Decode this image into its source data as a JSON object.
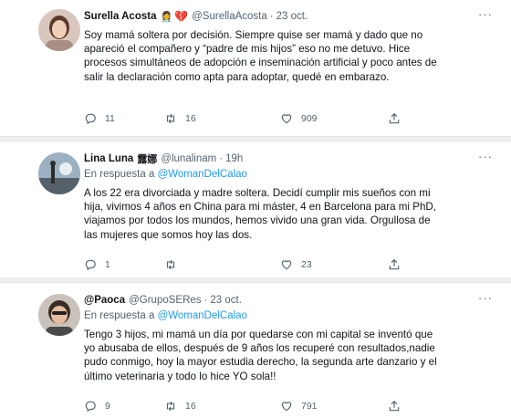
{
  "tweets": [
    {
      "name": "Surella Acosta",
      "badges": "👩‍⚕️",
      "heart": "💔",
      "handle": "@SurellaAcosta",
      "time": "23 oct.",
      "reply_prefix": "",
      "reply_mention": "@WomanDelCalao",
      "text": "Soy mamá soltera por decisión. Siempre quise ser mamá y dado que no\napareció el compañero y “padre de mis hijos” eso no me detuvo. Hice\nprocesos simultáneos de adopción e inseminación artificial y poco antes de\nsalir la declaración como apta para adoptar, quedé en embarazo.",
      "replies": "11",
      "retweets": "16",
      "likes": "909"
    },
    {
      "name": "Lina Luna",
      "badges": "露娜",
      "handle": "@lunalinam",
      "time": "19h",
      "reply_prefix": "En respuesta a",
      "reply_mention": "@WomanDelCalao",
      "text": "A los 22 era divorciada y madre soltera. Decidí cumplir mis sueños con mi\nhija, vivimos 4 años en China para mi máster,  4 en Barcelona para mi PhD,\nviajamos por todos los mundos, hemos vivido una gran vida. Orgullosa de\nlas mujeres que somos hoy las dos.",
      "replies": "1",
      "retweets": "",
      "likes": "23"
    },
    {
      "name": "@Paoca",
      "badges": "",
      "handle": "@GrupoSERes",
      "time": "23 oct.",
      "reply_prefix": "En respuesta a",
      "reply_mention": "@WomanDelCalao",
      "text": "Tengo 3 hijos, mi mamá un día por quedarse con mi capital se inventó que\nyo abusaba de ellos, después de 9 años los recuperé con resultados,nadie\npudo conmigo, hoy la mayor estudia derecho, la segunda arte danzario y el\núltimo veterinaria y todo lo hice YO sola!!",
      "replies": "9",
      "retweets": "16",
      "likes": "791"
    }
  ],
  "more_label": "···",
  "colors": {
    "accent": "#1d9bf0",
    "muted": "#536471",
    "text": "#0f1419"
  },
  "icons": [
    "reply-icon",
    "retweet-icon",
    "like-icon",
    "share-icon",
    "more-icon"
  ]
}
